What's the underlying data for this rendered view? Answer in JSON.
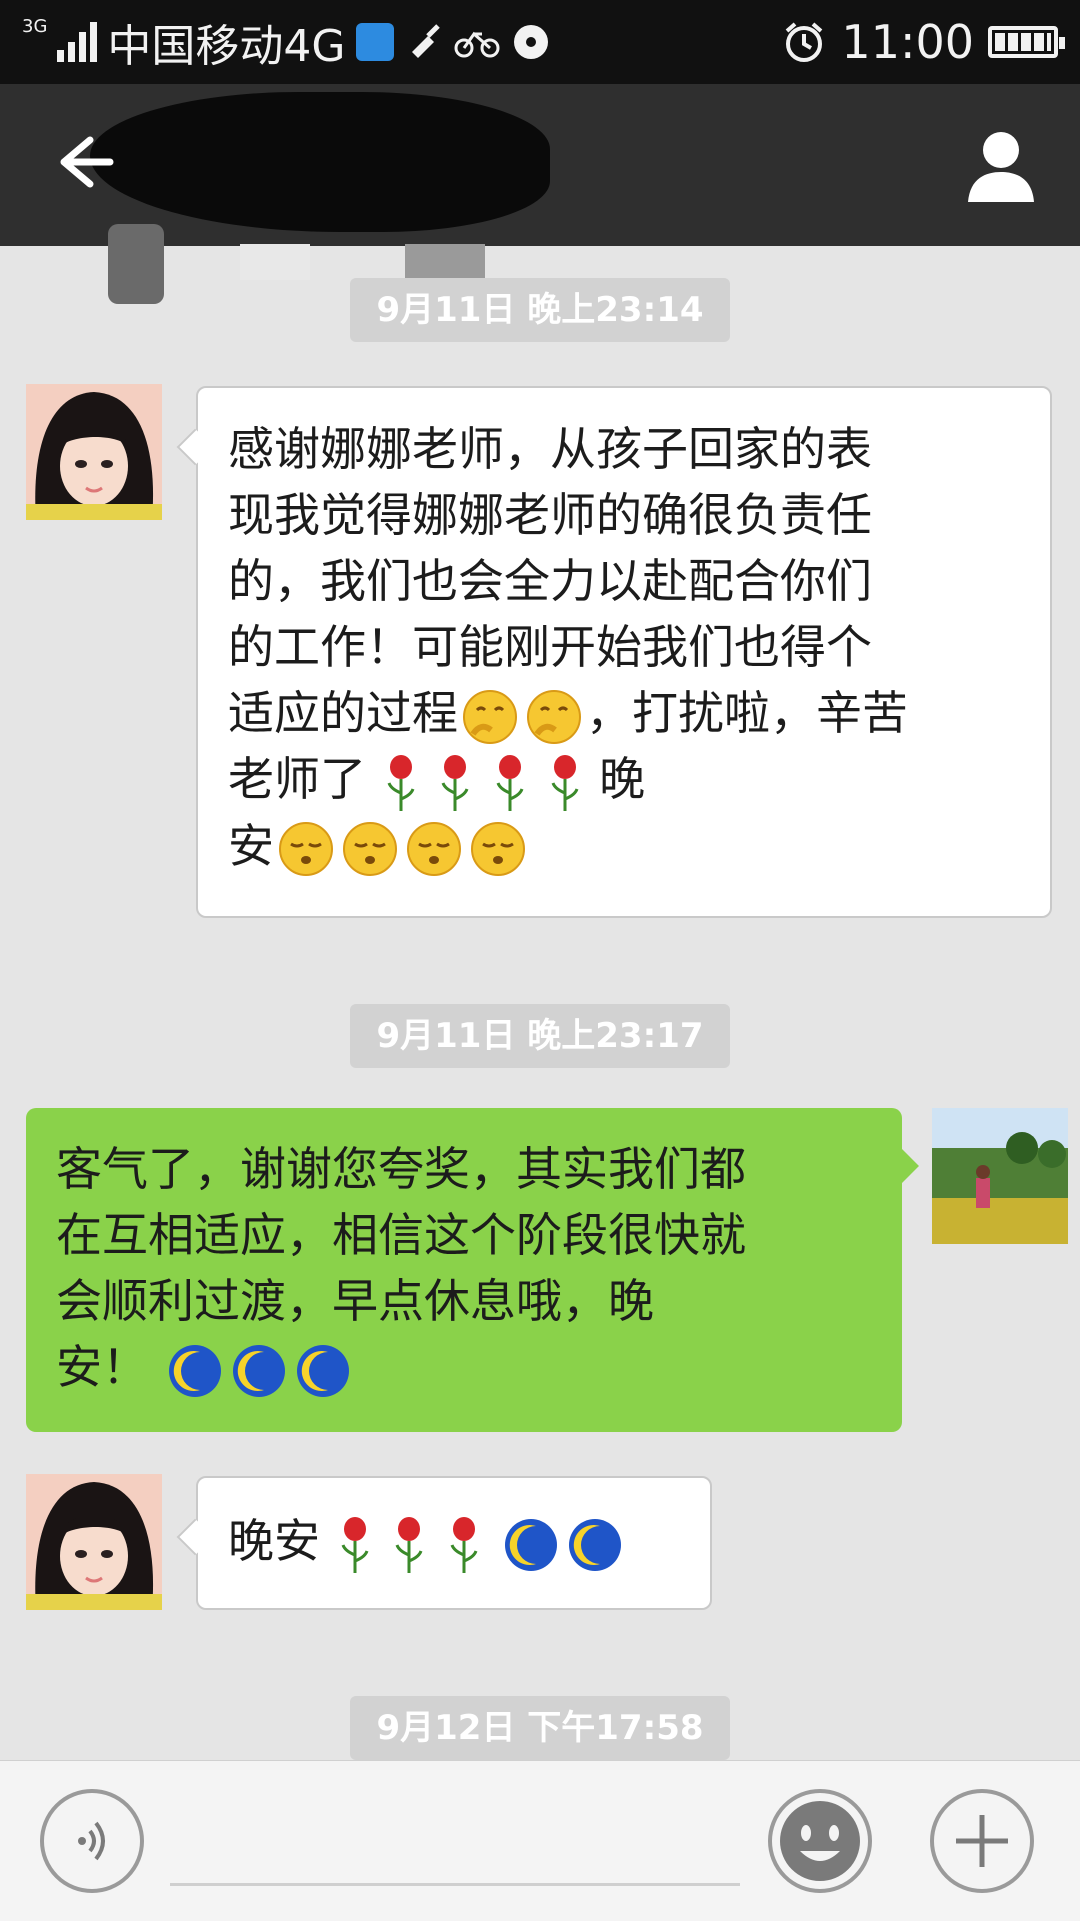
{
  "status_bar": {
    "network_small": "3G",
    "carrier": "中国移动4G",
    "time": "11:00"
  },
  "header": {
    "back_icon": "back-arrow-icon",
    "contact_icon": "person-icon"
  },
  "messages": [
    {
      "timestamp": "9月11日 晚上23:14"
    },
    {
      "direction": "incoming",
      "avatar": "girl-avatar",
      "lines": [
        "感谢娜娜老师，从孩子回家的表",
        "现我觉得娜娜老师的确很负责任",
        "的，我们也会全力以赴配合你们",
        "的工作！可能刚开始我们也得个"
      ],
      "line5_text": "适应的过程",
      "line5_tail": "，打扰啦，辛苦",
      "line6_text": "老师了",
      "line6_tail": "晚",
      "line7_text": "安"
    },
    {
      "timestamp": "9月11日 晚上23:17"
    },
    {
      "direction": "outgoing",
      "avatar": "landscape-avatar",
      "lines": [
        "客气了，谢谢您夸奖，其实我们都",
        "在互相适应，相信这个阶段很快就",
        "会顺利过渡，早点休息哦，晚"
      ],
      "last_text": "安！"
    },
    {
      "direction": "incoming",
      "avatar": "girl-avatar",
      "text": "晚安"
    },
    {
      "timestamp": "9月12日 下午17:58"
    }
  ],
  "colors": {
    "outgoing_bubble": "#8ad24a",
    "incoming_bubble": "#ffffff",
    "header_bg": "#2f2f2f",
    "chat_bg": "#e5e5e5"
  }
}
